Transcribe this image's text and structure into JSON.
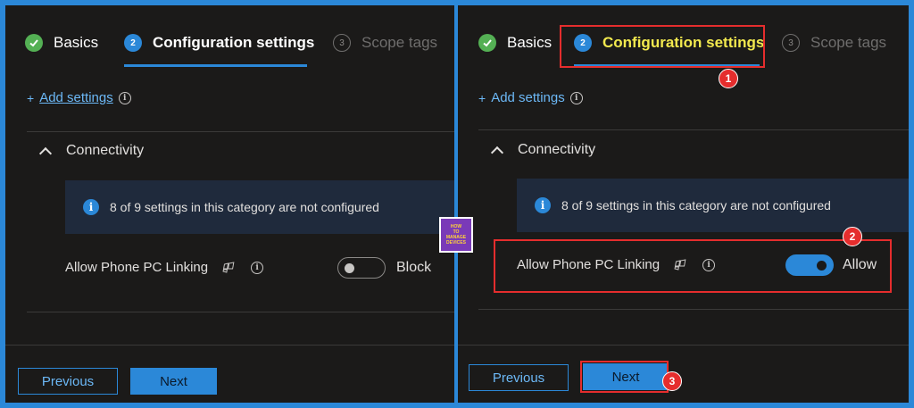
{
  "wizard_steps": {
    "basics": "Basics",
    "config": "Configuration settings",
    "scope": "Scope tags",
    "config_num": "2",
    "scope_num": "3"
  },
  "add_settings": {
    "plus": "+",
    "label": "Add settings",
    "info": "i"
  },
  "section": {
    "title": "Connectivity"
  },
  "banner": {
    "text": "8 of 9 settings in this category are not configured",
    "info": "i"
  },
  "setting": {
    "name": "Allow Phone PC Linking",
    "info": "i"
  },
  "left": {
    "toggle_state": "Block",
    "toggle_on": false
  },
  "right": {
    "toggle_state": "Allow",
    "toggle_on": true
  },
  "footer": {
    "previous": "Previous",
    "next": "Next"
  },
  "callouts": [
    "1",
    "2",
    "3"
  ],
  "logo": {
    "lines": [
      "HOW",
      "TO",
      "MANAGE",
      "DEVICES"
    ]
  },
  "colors": {
    "accent": "#2b88d8",
    "callout_red": "#e52d2d",
    "highlight_yellow": "#f2e94e",
    "success": "#54b054"
  }
}
